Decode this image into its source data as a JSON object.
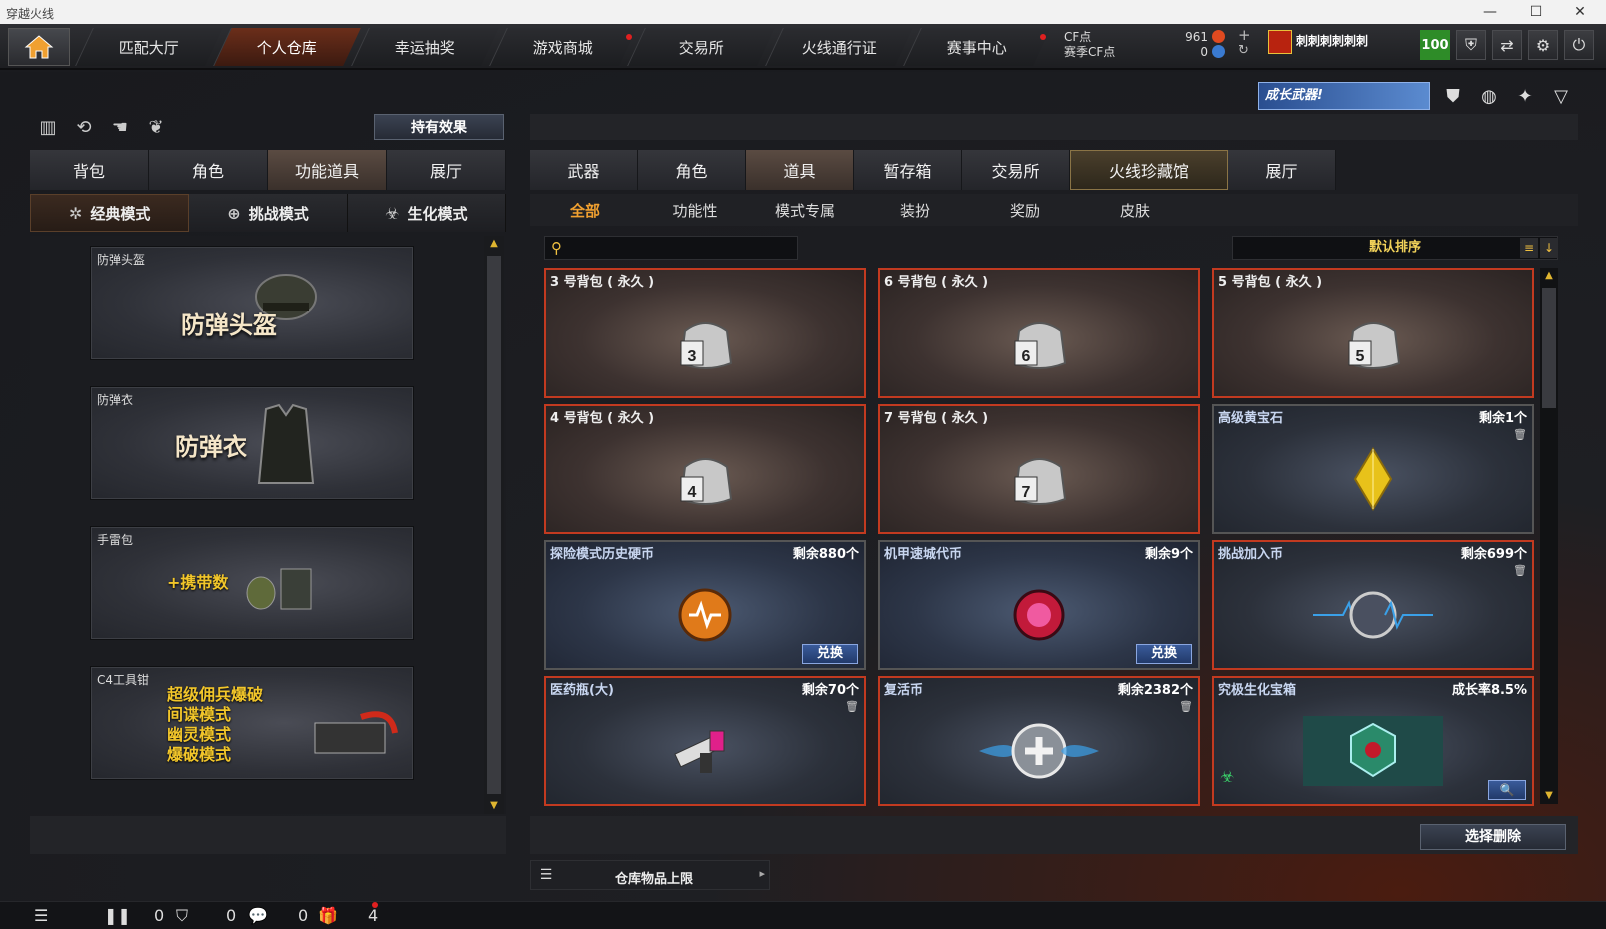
{
  "window": {
    "title": "穿越火线",
    "min": "—",
    "max": "☐",
    "close": "✕"
  },
  "topnav": {
    "tabs": [
      {
        "label": "匹配大厅"
      },
      {
        "label": "个人仓库"
      },
      {
        "label": "幸运抽奖"
      },
      {
        "label": "游戏商城"
      },
      {
        "label": "交易所"
      },
      {
        "label": "火线通行证"
      },
      {
        "label": "赛事中心"
      }
    ],
    "cf_label": "CF点",
    "season_cf_label": "赛季CF点",
    "cf_value": "961",
    "season_cf_value": "0",
    "player_name": "刺刺刺刺刺刺",
    "level": "100"
  },
  "left": {
    "effect_button": "持有效果",
    "tabs": [
      "背包",
      "角色",
      "功能道具",
      "展厅"
    ],
    "modes": [
      "经典模式",
      "挑战模式",
      "生化模式"
    ],
    "items": [
      {
        "label": "防弹头盔",
        "title": "防弹头盔"
      },
      {
        "label": "防弹衣",
        "title": "防弹衣"
      },
      {
        "label": "手雷包",
        "title": "+携带数"
      },
      {
        "label": "C4工具钳",
        "lines": [
          "超级佣兵爆破",
          "间谍模式",
          "幽灵模式",
          "爆破模式"
        ]
      }
    ]
  },
  "right": {
    "banner": "成长武器!",
    "tabs": [
      "武器",
      "角色",
      "道具",
      "暂存箱",
      "交易所",
      "火线珍藏馆",
      "展厅"
    ],
    "subtabs": [
      "全部",
      "功能性",
      "模式专属",
      "装扮",
      "奖励",
      "皮肤"
    ],
    "search": {
      "placeholder": ""
    },
    "sort": "默认排序",
    "items": [
      {
        "name": "3 号背包 ( 永久 )",
        "bag": "3"
      },
      {
        "name": "6 号背包 ( 永久 )",
        "bag": "6"
      },
      {
        "name": "5 号背包 ( 永久 )",
        "bag": "5"
      },
      {
        "name": "4 号背包 ( 永久 )",
        "bag": "4"
      },
      {
        "name": "7 号背包 ( 永久 )",
        "bag": "7"
      },
      {
        "name": "高级黄宝石",
        "qty": "剩余1个"
      },
      {
        "name": "探险模式历史硬币",
        "qty": "剩余880个",
        "action": "兑换"
      },
      {
        "name": "机甲速城代币",
        "qty": "剩余9个",
        "action": "兑换"
      },
      {
        "name": "挑战加入币",
        "qty": "剩余699个"
      },
      {
        "name": "医药瓶(大)",
        "qty": "剩余70个"
      },
      {
        "name": "复活币",
        "qty": "剩余2382个"
      },
      {
        "name": "究极生化宝箱",
        "qty": "成长率8.5%"
      }
    ],
    "delete_button": "选择删除",
    "storage_limit": "仓库物品上限"
  },
  "status": {
    "a": "0",
    "b": "0",
    "c": "0",
    "d": "4"
  },
  "colors": {
    "accent": "#c23a20",
    "gold": "#f0c040",
    "level": "#2e8c28"
  }
}
